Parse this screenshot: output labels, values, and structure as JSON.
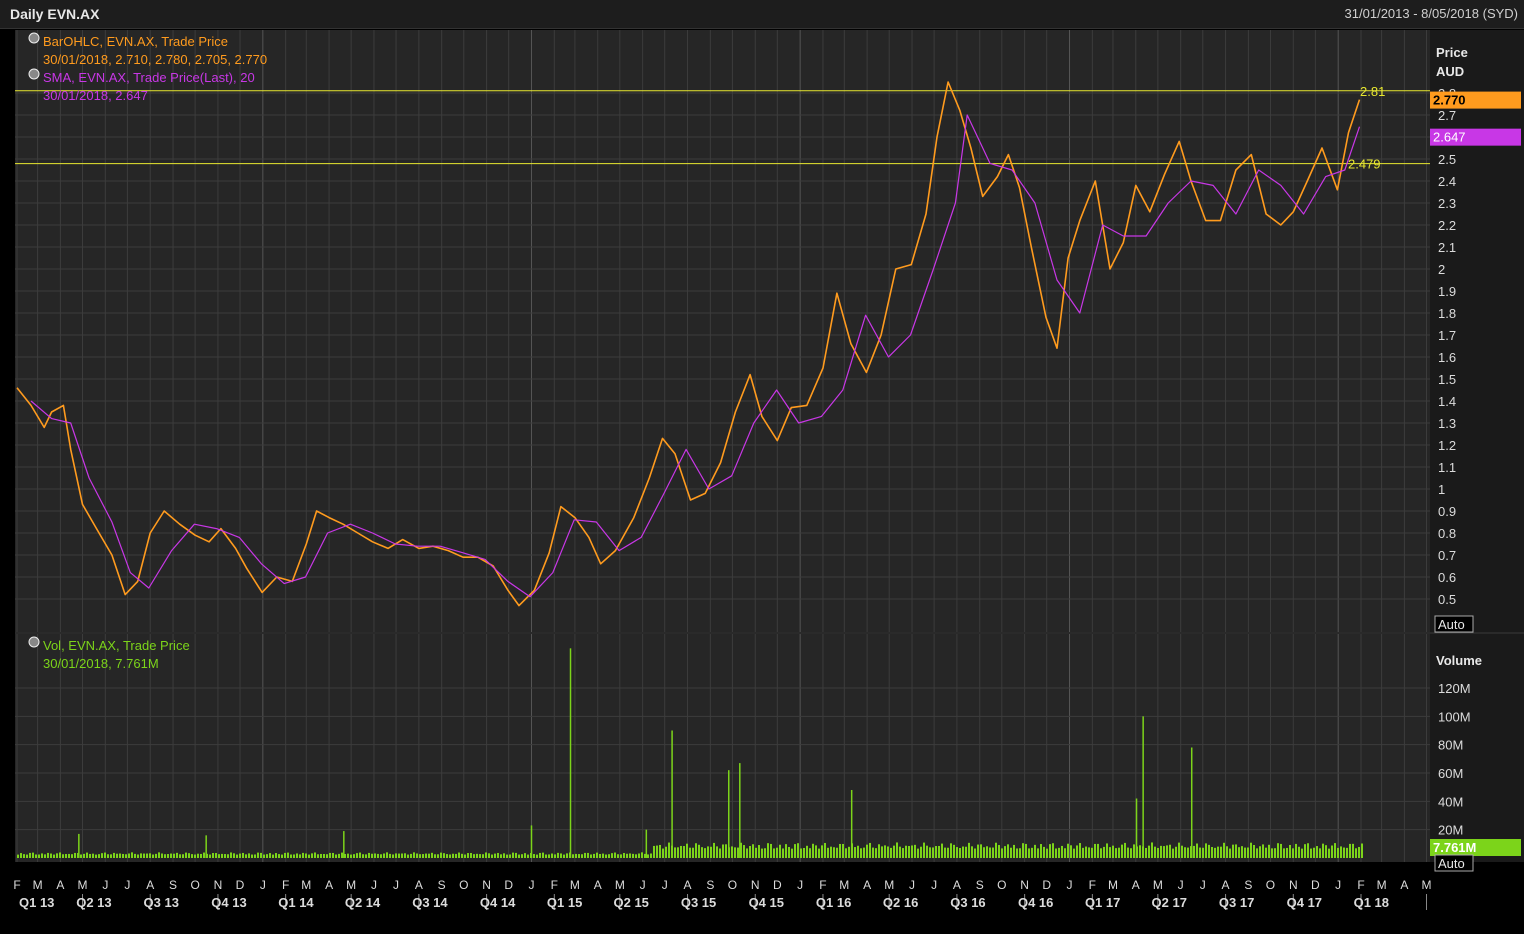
{
  "header": {
    "title": "Daily EVN.AX",
    "date_range": "31/01/2013 - 8/05/2018 (SYD)"
  },
  "colors": {
    "background": "#262626",
    "grid": "#3c3c3c",
    "price": "#ff9b1e",
    "sma": "#c837e6",
    "volume": "#7cd41a",
    "hline": "#e8e830",
    "text": "#dcdcdc"
  },
  "legend": {
    "price_label": "BarOHLC, EVN.AX, Trade Price",
    "price_values": "30/01/2018, 2.710, 2.780, 2.705, 2.770",
    "sma_label": "SMA, EVN.AX, Trade Price(Last),  20",
    "sma_values": "30/01/2018, 2.647",
    "vol_label": "Vol, EVN.AX, Trade Price",
    "vol_values": "30/01/2018, 7.761M"
  },
  "axis": {
    "price_title": "Price",
    "price_unit": "AUD",
    "volume_title": "Volume",
    "auto_label": "Auto",
    "price_ticks": [
      "0.5",
      "0.6",
      "0.7",
      "0.8",
      "0.9",
      "1",
      "1.1",
      "1.2",
      "1.3",
      "1.4",
      "1.5",
      "1.6",
      "1.7",
      "1.8",
      "1.9",
      "2",
      "2.1",
      "2.2",
      "2.3",
      "2.4",
      "2.5",
      "2.6",
      "2.7",
      "2.8"
    ],
    "volume_ticks": [
      "20M",
      "40M",
      "60M",
      "80M",
      "100M",
      "120M"
    ],
    "months": [
      "F",
      "M",
      "A",
      "M",
      "J",
      "J",
      "A",
      "S",
      "O",
      "N",
      "D",
      "J",
      "F",
      "M",
      "A",
      "M",
      "J",
      "J",
      "A",
      "S",
      "O",
      "N",
      "D",
      "J",
      "F",
      "M",
      "A",
      "M",
      "J",
      "J",
      "A",
      "S",
      "O",
      "N",
      "D",
      "J",
      "F",
      "M",
      "A",
      "M",
      "J",
      "J",
      "A",
      "S",
      "O",
      "N",
      "D",
      "J",
      "F",
      "M",
      "A",
      "M",
      "J",
      "J",
      "A",
      "S",
      "O",
      "N",
      "D",
      "J",
      "F",
      "M",
      "A",
      "M",
      "J",
      "J",
      "A",
      "S",
      "O",
      "N",
      "D",
      "J",
      "F",
      "M",
      "A",
      "M"
    ],
    "quarters": [
      "Q1 13",
      "Q2 13",
      "Q3 13",
      "Q4 13",
      "Q1 14",
      "Q2 14",
      "Q3 14",
      "Q4 14",
      "Q1 15",
      "Q2 15",
      "Q3 15",
      "Q4 15",
      "Q1 16",
      "Q2 16",
      "Q3 16",
      "Q4 16",
      "Q1 17",
      "Q2 17",
      "Q3 17",
      "Q4 17",
      "Q1 18"
    ]
  },
  "badges": {
    "last_price": "2.770",
    "last_sma": "2.647",
    "last_volume": "7.761M",
    "hline_upper": "2.81",
    "hline_lower": "2.479"
  },
  "chart_data": [
    {
      "type": "line",
      "title": "Daily EVN.AX",
      "ylabel": "Price AUD",
      "ylim": [
        0.4,
        2.95
      ],
      "grid": true,
      "legend": "top-left",
      "series": [
        {
          "name": "BarOHLC, EVN.AX, Trade Price",
          "x": [
            "2013-02-01",
            "2013-02-20",
            "2013-03-10",
            "2013-03-20",
            "2013-04-05",
            "2013-04-15",
            "2013-05-01",
            "2013-05-20",
            "2013-06-10",
            "2013-06-28",
            "2013-07-15",
            "2013-08-01",
            "2013-08-20",
            "2013-09-10",
            "2013-10-01",
            "2013-10-20",
            "2013-11-05",
            "2013-11-25",
            "2013-12-10",
            "2013-12-31",
            "2014-01-20",
            "2014-02-10",
            "2014-03-01",
            "2014-03-15",
            "2014-04-01",
            "2014-04-20",
            "2014-05-10",
            "2014-05-30",
            "2014-06-20",
            "2014-07-10",
            "2014-08-01",
            "2014-08-20",
            "2014-09-10",
            "2014-09-30",
            "2014-10-20",
            "2014-11-10",
            "2014-11-30",
            "2014-12-15",
            "2015-01-05",
            "2015-01-25",
            "2015-02-10",
            "2015-03-01",
            "2015-03-20",
            "2015-04-05",
            "2015-04-25",
            "2015-05-20",
            "2015-06-10",
            "2015-06-28",
            "2015-07-15",
            "2015-08-05",
            "2015-08-25",
            "2015-09-15",
            "2015-10-05",
            "2015-10-25",
            "2015-11-10",
            "2015-12-01",
            "2015-12-20",
            "2016-01-10",
            "2016-02-01",
            "2016-02-20",
            "2016-03-10",
            "2016-03-31",
            "2016-04-20",
            "2016-05-10",
            "2016-05-31",
            "2016-06-20",
            "2016-07-05",
            "2016-07-20",
            "2016-08-05",
            "2016-08-20",
            "2016-09-05",
            "2016-09-25",
            "2016-10-10",
            "2016-10-25",
            "2016-11-10",
            "2016-11-30",
            "2016-12-15",
            "2016-12-30",
            "2017-01-15",
            "2017-02-05",
            "2017-02-25",
            "2017-03-15",
            "2017-04-01",
            "2017-04-20",
            "2017-05-10",
            "2017-05-30",
            "2017-06-15",
            "2017-07-05",
            "2017-07-25",
            "2017-08-15",
            "2017-09-05",
            "2017-09-25",
            "2017-10-15",
            "2017-11-01",
            "2017-11-20",
            "2017-12-10",
            "2017-12-31",
            "2018-01-15",
            "2018-01-30"
          ],
          "values": [
            1.46,
            1.38,
            1.28,
            1.35,
            1.38,
            1.18,
            0.93,
            0.82,
            0.7,
            0.52,
            0.58,
            0.8,
            0.9,
            0.84,
            0.79,
            0.76,
            0.82,
            0.73,
            0.64,
            0.53,
            0.6,
            0.58,
            0.75,
            0.9,
            0.87,
            0.84,
            0.8,
            0.76,
            0.73,
            0.77,
            0.73,
            0.74,
            0.72,
            0.69,
            0.69,
            0.65,
            0.54,
            0.47,
            0.54,
            0.71,
            0.92,
            0.87,
            0.78,
            0.66,
            0.72,
            0.87,
            1.05,
            1.23,
            1.16,
            0.95,
            0.98,
            1.12,
            1.35,
            1.52,
            1.33,
            1.22,
            1.37,
            1.38,
            1.55,
            1.89,
            1.66,
            1.53,
            1.7,
            2.0,
            2.02,
            2.25,
            2.6,
            2.85,
            2.72,
            2.55,
            2.33,
            2.42,
            2.52,
            2.37,
            2.1,
            1.78,
            1.64,
            2.05,
            2.22,
            2.4,
            2.0,
            2.12,
            2.38,
            2.26,
            2.43,
            2.58,
            2.4,
            2.22,
            2.22,
            2.45,
            2.52,
            2.25,
            2.2,
            2.26,
            2.4,
            2.55,
            2.36,
            2.62,
            2.77
          ]
        },
        {
          "name": "SMA, EVN.AX, Trade Price(Last),  20",
          "x": [
            "2013-02-20",
            "2013-03-20",
            "2013-04-15",
            "2013-05-10",
            "2013-06-10",
            "2013-07-05",
            "2013-07-30",
            "2013-08-30",
            "2013-09-30",
            "2013-10-30",
            "2013-11-30",
            "2013-12-30",
            "2014-01-30",
            "2014-02-28",
            "2014-03-30",
            "2014-04-30",
            "2014-05-30",
            "2014-06-30",
            "2014-07-30",
            "2014-08-30",
            "2014-09-30",
            "2014-10-30",
            "2014-11-30",
            "2014-12-30",
            "2015-01-30",
            "2015-02-28",
            "2015-03-30",
            "2015-04-30",
            "2015-05-30",
            "2015-06-30",
            "2015-07-30",
            "2015-08-30",
            "2015-09-30",
            "2015-10-30",
            "2015-11-30",
            "2015-12-30",
            "2016-01-30",
            "2016-02-28",
            "2016-03-30",
            "2016-04-30",
            "2016-05-30",
            "2016-06-30",
            "2016-07-30",
            "2016-08-15",
            "2016-09-15",
            "2016-10-15",
            "2016-11-15",
            "2016-12-15",
            "2017-01-15",
            "2017-02-15",
            "2017-03-15",
            "2017-04-15",
            "2017-05-15",
            "2017-06-15",
            "2017-07-15",
            "2017-08-15",
            "2017-09-15",
            "2017-10-15",
            "2017-11-15",
            "2017-12-15",
            "2018-01-10",
            "2018-01-30"
          ],
          "values": [
            1.4,
            1.32,
            1.3,
            1.05,
            0.85,
            0.62,
            0.55,
            0.72,
            0.84,
            0.82,
            0.78,
            0.66,
            0.57,
            0.6,
            0.8,
            0.84,
            0.8,
            0.75,
            0.74,
            0.74,
            0.71,
            0.68,
            0.58,
            0.51,
            0.62,
            0.86,
            0.85,
            0.72,
            0.78,
            0.98,
            1.18,
            1.0,
            1.06,
            1.3,
            1.45,
            1.3,
            1.33,
            1.45,
            1.79,
            1.6,
            1.7,
            2.0,
            2.3,
            2.7,
            2.48,
            2.45,
            2.3,
            1.95,
            1.8,
            2.2,
            2.15,
            2.15,
            2.3,
            2.4,
            2.38,
            2.25,
            2.45,
            2.38,
            2.25,
            2.42,
            2.45,
            2.647
          ]
        }
      ],
      "hlines": [
        2.81,
        2.479
      ]
    },
    {
      "type": "bar",
      "title": "Vol, EVN.AX, Trade Price",
      "ylabel": "Volume",
      "ylim": [
        0,
        140
      ],
      "unit": "M",
      "baseline_before": "2015-06-15",
      "baseline_before_value": 4,
      "baseline_after_value": 11,
      "spikes": {
        "x": [
          "2013-04-25",
          "2013-10-15",
          "2014-04-20",
          "2014-12-31",
          "2015-02-22",
          "2015-06-05",
          "2015-07-10",
          "2015-09-25",
          "2015-10-10",
          "2016-03-10",
          "2017-04-01",
          "2017-04-10",
          "2017-06-15"
        ],
        "values": [
          17,
          16,
          19,
          23,
          148,
          20,
          90,
          62,
          67,
          48,
          42,
          100,
          78
        ]
      },
      "last_value": 7.761
    }
  ]
}
